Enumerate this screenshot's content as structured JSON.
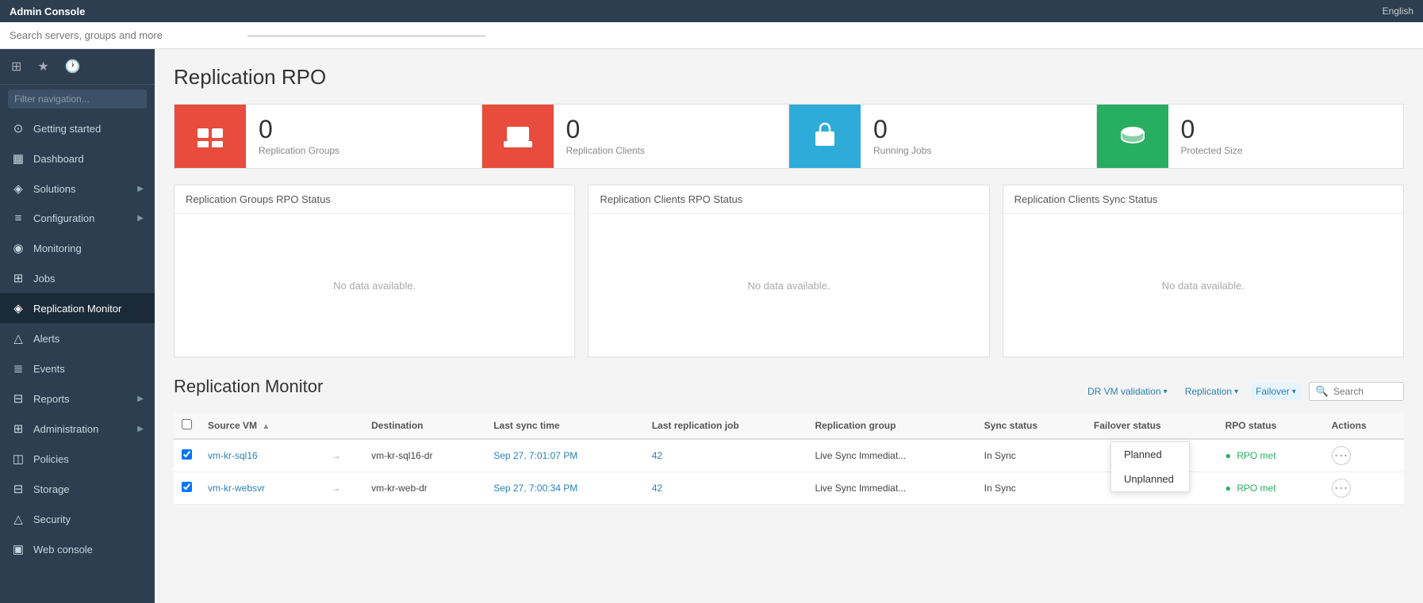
{
  "app": {
    "title": "Admin Console",
    "language": "English"
  },
  "topbar": {
    "search_placeholder": "Search servers, groups and more"
  },
  "sidebar": {
    "filter_placeholder": "Filter navigation...",
    "items": [
      {
        "id": "getting-started",
        "label": "Getting started",
        "icon": "⊙",
        "active": false
      },
      {
        "id": "dashboard",
        "label": "Dashboard",
        "icon": "▦",
        "active": false
      },
      {
        "id": "solutions",
        "label": "Solutions",
        "icon": "◈",
        "active": false,
        "arrow": true
      },
      {
        "id": "configuration",
        "label": "Configuration",
        "icon": "≡",
        "active": false,
        "arrow": true
      },
      {
        "id": "monitoring",
        "label": "Monitoring",
        "icon": "◉",
        "active": false
      },
      {
        "id": "jobs",
        "label": "Jobs",
        "icon": "⊞",
        "active": false
      },
      {
        "id": "replication-monitor",
        "label": "Replication Monitor",
        "icon": "◈",
        "active": true
      },
      {
        "id": "alerts",
        "label": "Alerts",
        "icon": "△",
        "active": false
      },
      {
        "id": "events",
        "label": "Events",
        "icon": "≣",
        "active": false
      },
      {
        "id": "reports",
        "label": "Reports",
        "icon": "⊟",
        "active": false,
        "arrow": true
      },
      {
        "id": "administration",
        "label": "Administration",
        "icon": "⊞",
        "active": false,
        "arrow": true
      },
      {
        "id": "policies",
        "label": "Policies",
        "icon": "◫",
        "active": false
      },
      {
        "id": "storage",
        "label": "Storage",
        "icon": "⊟",
        "active": false
      },
      {
        "id": "security",
        "label": "Security",
        "icon": "△",
        "active": false
      },
      {
        "id": "web-console",
        "label": "Web console",
        "icon": "▣",
        "active": false
      }
    ]
  },
  "page": {
    "title": "Replication RPO",
    "stat_cards": [
      {
        "id": "replication-groups",
        "number": "0",
        "label": "Replication Groups",
        "color": "#e74c3c",
        "icon_type": "groups"
      },
      {
        "id": "replication-clients",
        "number": "0",
        "label": "Replication Clients",
        "color": "#e74c3c",
        "icon_type": "clients"
      },
      {
        "id": "running-jobs",
        "number": "0",
        "label": "Running Jobs",
        "color": "#2eabd8",
        "icon_type": "jobs"
      },
      {
        "id": "protected-size",
        "number": "0",
        "label": "Protected Size",
        "color": "#27ae60",
        "icon_type": "size"
      }
    ],
    "status_panels": [
      {
        "id": "rpo-groups",
        "title": "Replication Groups RPO Status",
        "no_data": "No data available."
      },
      {
        "id": "rpo-clients",
        "title": "Replication Clients RPO Status",
        "no_data": "No data available."
      },
      {
        "id": "sync-clients",
        "title": "Replication Clients Sync Status",
        "no_data": "No data available."
      }
    ],
    "monitor_section": {
      "title": "Replication Monitor",
      "filters": {
        "dr_vm_validation": "DR VM validation",
        "replication": "Replication",
        "failover": "Failover",
        "search_placeholder": "Search"
      },
      "failover_dropdown": {
        "items": [
          "Planned",
          "Unplanned"
        ]
      },
      "table_headers": [
        {
          "id": "checkbox",
          "label": ""
        },
        {
          "id": "source-vm",
          "label": "Source VM",
          "sortable": true
        },
        {
          "id": "arrow",
          "label": ""
        },
        {
          "id": "destination",
          "label": "Destination"
        },
        {
          "id": "last-sync-time",
          "label": "Last sync time"
        },
        {
          "id": "last-replication-job",
          "label": "Last replication job"
        },
        {
          "id": "replication-group",
          "label": "Replication group"
        },
        {
          "id": "sync-status",
          "label": "Sync status"
        },
        {
          "id": "failover-status",
          "label": "Failover status"
        },
        {
          "id": "rpo-status",
          "label": "RPO status"
        },
        {
          "id": "actions",
          "label": "Actions"
        }
      ],
      "table_rows": [
        {
          "checkbox": true,
          "source_vm": "vm-kr-sql16",
          "destination": "vm-kr-sql16-dr",
          "last_sync_time": "Sep 27, 7:01:07 PM",
          "last_replication_job": "42",
          "replication_group": "Live Sync Immediat...",
          "sync_status": "In Sync",
          "failover_status": "",
          "rpo_status": "RPO met",
          "rpo_met": true
        },
        {
          "checkbox": true,
          "source_vm": "vm-kr-websvr",
          "destination": "vm-kr-web-dr",
          "last_sync_time": "Sep 27, 7:00:34 PM",
          "last_replication_job": "42",
          "replication_group": "Live Sync Immediat...",
          "sync_status": "In Sync",
          "failover_status": "",
          "rpo_status": "RPO met",
          "rpo_met": true
        }
      ]
    }
  }
}
